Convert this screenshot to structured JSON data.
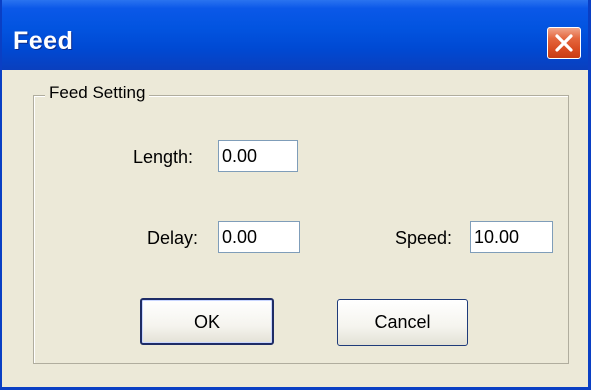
{
  "window": {
    "title": "Feed",
    "close_icon": "close-icon"
  },
  "group": {
    "label": "Feed Setting"
  },
  "fields": {
    "length": {
      "label": "Length:",
      "value": "0.00"
    },
    "delay": {
      "label": "Delay:",
      "value": "0.00"
    },
    "speed": {
      "label": "Speed:",
      "value": "10.00"
    }
  },
  "buttons": {
    "ok": "OK",
    "cancel": "Cancel"
  },
  "colors": {
    "titlebar": "#0054e3",
    "close_button": "#d94c22",
    "dialog_bg": "#ece9d8"
  }
}
